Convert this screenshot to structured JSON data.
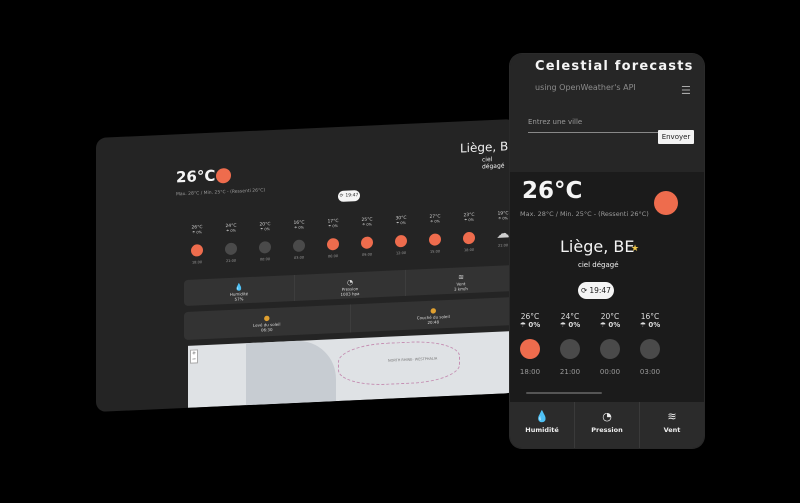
{
  "desktop": {
    "temp": "26°C",
    "subtitle": "Max. 28°C / Min. 25°C - (Ressenti 26°C)",
    "city": "Liège, BE",
    "description": "ciel dégagé",
    "refresh_time": "19:47",
    "hourly": [
      {
        "temp": "26°C",
        "rain": "0%",
        "time": "18:00",
        "state": "sun"
      },
      {
        "temp": "24°C",
        "rain": "0%",
        "time": "21:00",
        "state": "night"
      },
      {
        "temp": "20°C",
        "rain": "0%",
        "time": "00:00",
        "state": "night"
      },
      {
        "temp": "16°C",
        "rain": "0%",
        "time": "03:00",
        "state": "night"
      },
      {
        "temp": "17°C",
        "rain": "0%",
        "time": "06:00",
        "state": "sun"
      },
      {
        "temp": "25°C",
        "rain": "0%",
        "time": "09:00",
        "state": "sun"
      },
      {
        "temp": "30°C",
        "rain": "0%",
        "time": "12:00",
        "state": "sun"
      },
      {
        "temp": "27°C",
        "rain": "0%",
        "time": "15:00",
        "state": "sun"
      },
      {
        "temp": "23°C",
        "rain": "0%",
        "time": "18:00",
        "state": "sun"
      },
      {
        "temp": "19°C",
        "rain": "0%",
        "time": "21:00",
        "state": "cloud"
      }
    ],
    "stats": [
      {
        "label": "Humidité",
        "value": "57%",
        "icon": "water-drop-icon"
      },
      {
        "label": "Pression",
        "value": "1003 hpa",
        "icon": "gauge-icon"
      },
      {
        "label": "Vent",
        "value": "3 km/h",
        "icon": "wind-icon"
      }
    ],
    "sun_times": [
      {
        "label": "Levé du soleil",
        "value": "06:30",
        "icon": "sunrise-icon"
      },
      {
        "label": "Couché du soleil",
        "value": "20:48",
        "icon": "sunset-icon"
      }
    ],
    "map_label": "NORTH RHINE- WESTPHALIA"
  },
  "phone": {
    "app_title": "Celestial forecasts",
    "app_subtitle": "using OpenWeather's API",
    "city_placeholder": "Entrez une ville",
    "send_label": "Envoyer",
    "temp": "26°C",
    "subtitle": "Max. 28°C / Min. 25°C - (Ressenti 26°C)",
    "city": "Liège, BE",
    "description": "ciel dégagé",
    "refresh_time": "19:47",
    "hourly": [
      {
        "temp": "26°C",
        "rain": "0%",
        "time": "18:00",
        "state": "sun"
      },
      {
        "temp": "24°C",
        "rain": "0%",
        "time": "21:00",
        "state": "night"
      },
      {
        "temp": "20°C",
        "rain": "0%",
        "time": "00:00",
        "state": "night"
      },
      {
        "temp": "16°C",
        "rain": "0%",
        "time": "03:00",
        "state": "night"
      }
    ],
    "stats": [
      {
        "label": "Humidité",
        "icon": "water-drop-icon"
      },
      {
        "label": "Pression",
        "icon": "gauge-icon"
      },
      {
        "label": "Vent",
        "icon": "wind-icon"
      }
    ]
  },
  "colors": {
    "accent": "#ee6c4d",
    "star": "#f2c94c",
    "background": "#000000",
    "panel": "#242424"
  }
}
